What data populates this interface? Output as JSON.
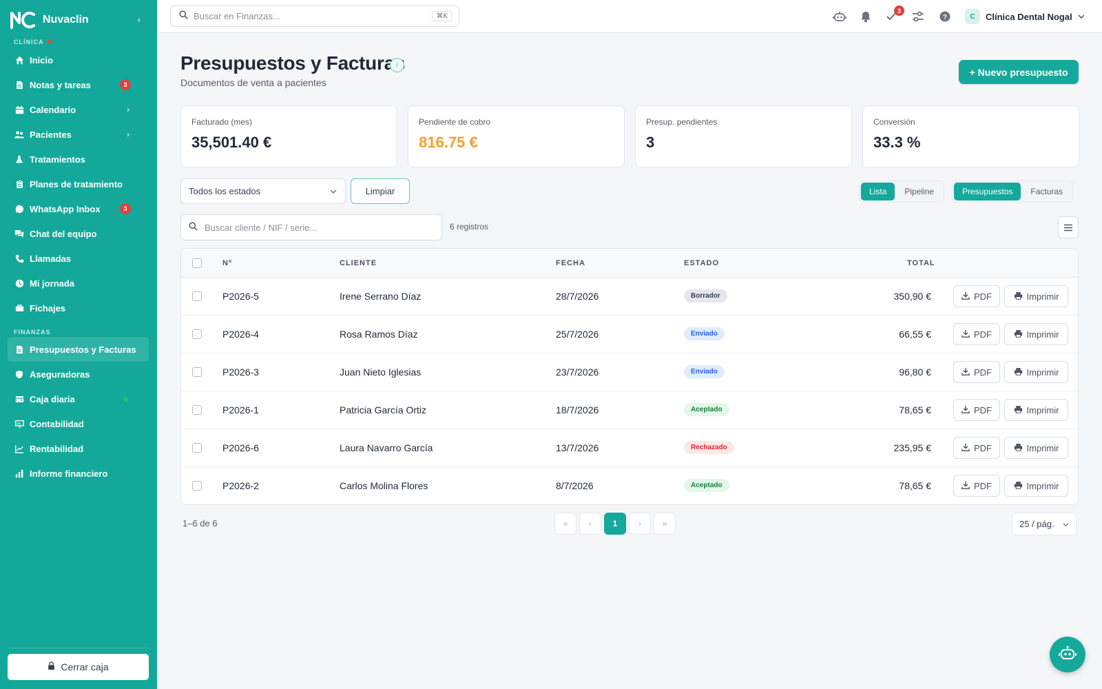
{
  "app": {
    "name": "Nuvaclin"
  },
  "sidebar": {
    "section_clinic": "CLÍNICA",
    "section_finance": "FINANZAS",
    "items": [
      {
        "label": "Inicio",
        "icon": "home-icon"
      },
      {
        "label": "Notas y tareas",
        "icon": "note-icon",
        "badge": "3"
      },
      {
        "label": "Calendario",
        "icon": "calendar-icon"
      },
      {
        "label": "Pacientes",
        "icon": "users-icon"
      },
      {
        "label": "Tratamientos",
        "icon": "flask-icon"
      },
      {
        "label": "Planes de tratamiento",
        "icon": "clipboard-icon"
      },
      {
        "label": "WhatsApp Inbox",
        "icon": "whatsapp-icon",
        "badge": "3"
      },
      {
        "label": "Chat del equipo",
        "icon": "chat-icon"
      },
      {
        "label": "Llamadas",
        "icon": "phone-icon"
      },
      {
        "label": "Mi jornada",
        "icon": "clock-icon"
      },
      {
        "label": "Fichajes",
        "icon": "briefcase-icon"
      }
    ],
    "finance_items": [
      {
        "label": "Presupuestos y Facturas",
        "icon": "document-icon"
      },
      {
        "label": "Aseguradoras",
        "icon": "shield-icon"
      },
      {
        "label": "Caja diaria",
        "icon": "wallet-icon"
      },
      {
        "label": "Contabilidad",
        "icon": "ledger-icon"
      },
      {
        "label": "Rentabilidad",
        "icon": "trend-icon"
      },
      {
        "label": "Informe financiero",
        "icon": "bar-chart-icon"
      }
    ],
    "close_cash": "Cerrar caja"
  },
  "topbar": {
    "search_placeholder": "Buscar en Finanzas...",
    "shortcut": "⌘K",
    "tasks_badge": "3",
    "account_initial": "C",
    "account_name": "Clínica Dental Nogal"
  },
  "page": {
    "title": "Presupuestos y Facturas",
    "subtitle": "Documentos de venta a pacientes",
    "new_button": "+ Nuevo presupuesto"
  },
  "kpis": [
    {
      "label": "Facturado (mes)",
      "value": "35,501.40 €"
    },
    {
      "label": "Pendiente de cobro",
      "value": "816.75 €"
    },
    {
      "label": "Presup. pendientes",
      "value": "3"
    },
    {
      "label": "Conversión",
      "value": "33.3 %"
    }
  ],
  "filters": {
    "status_select": "Todos los estados",
    "clear": "Limpiar",
    "view_list": "Lista",
    "view_pipeline": "Pipeline",
    "doc_quotes": "Presupuestos",
    "doc_invoices": "Facturas",
    "search_placeholder": "Buscar cliente / NIF / serie...",
    "record_count": "6 registros"
  },
  "table": {
    "headers": {
      "number": "Nº",
      "client": "CLIENTE",
      "date": "FECHA",
      "status": "ESTADO",
      "total": "TOTAL"
    },
    "pdf_label": "PDF",
    "print_label": "Imprimir",
    "rows": [
      {
        "number": "P2026-5",
        "client": "Irene Serrano Díaz",
        "date": "28/7/2026",
        "status": "Borrador",
        "total": "350,90 €"
      },
      {
        "number": "P2026-4",
        "client": "Rosa Ramos Díaz",
        "date": "25/7/2026",
        "status": "Enviado",
        "total": "66,55 €"
      },
      {
        "number": "P2026-3",
        "client": "Juan Nieto Iglesias",
        "date": "23/7/2026",
        "status": "Enviado",
        "total": "96,80 €"
      },
      {
        "number": "P2026-1",
        "client": "Patricia García Ortiz",
        "date": "18/7/2026",
        "status": "Aceptado",
        "total": "78,65 €"
      },
      {
        "number": "P2026-6",
        "client": "Laura Navarro García",
        "date": "13/7/2026",
        "status": "Rechazado",
        "total": "235,95 €"
      },
      {
        "number": "P2026-2",
        "client": "Carlos Molina Flores",
        "date": "8/7/2026",
        "status": "Aceptado",
        "total": "78,65 €"
      }
    ]
  },
  "pagination": {
    "range": "1–6 de 6",
    "first": "«",
    "prev": "‹",
    "current": "1",
    "next": "›",
    "last": "»",
    "per_page": "25 / pág."
  },
  "colors": {
    "brand": "#13a89a",
    "badge_red": "#e53e3e",
    "warning": "#f2a02c",
    "status_draft": "#e5e7eb",
    "status_sent": "#e0ecff",
    "status_accepted": "#e3f7ea",
    "status_rejected": "#fde8e8"
  }
}
